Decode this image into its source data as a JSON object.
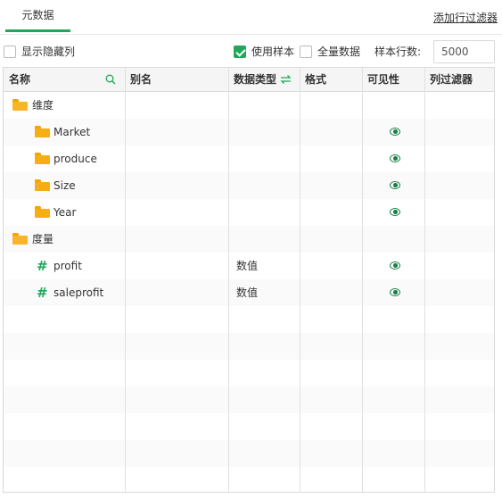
{
  "tabs": [
    {
      "label": "元数据",
      "active": true
    }
  ],
  "add_filter_label": "添加行过滤器",
  "toolbar": {
    "show_hidden_label": "显示隐藏列",
    "show_hidden_checked": false,
    "use_sample_label": "使用样本",
    "use_sample_checked": true,
    "full_data_label": "全量数据",
    "full_data_checked": false,
    "sample_rows_label": "样本行数:",
    "sample_rows_value": "5000"
  },
  "columns": {
    "name": "名称",
    "alias": "别名",
    "datatype": "数据类型",
    "format": "格式",
    "visibility": "可见性",
    "col_filter": "列过滤器"
  },
  "rows": [
    {
      "name": "维度",
      "icon": "folder-open-icon",
      "datatype": "",
      "visible": false
    },
    {
      "name": "Market",
      "icon": "folder-icon",
      "datatype": "",
      "visible": true
    },
    {
      "name": "produce",
      "icon": "folder-icon",
      "datatype": "",
      "visible": true
    },
    {
      "name": "Size",
      "icon": "folder-icon",
      "datatype": "",
      "visible": true
    },
    {
      "name": "Year",
      "icon": "folder-icon",
      "datatype": "",
      "visible": true
    },
    {
      "name": "度量",
      "icon": "folder-open-icon",
      "datatype": "",
      "visible": false
    },
    {
      "name": "profit",
      "icon": "hash-icon",
      "datatype": "数值",
      "visible": true
    },
    {
      "name": "saleprofit",
      "icon": "hash-icon",
      "datatype": "数值",
      "visible": true
    }
  ],
  "colors": {
    "accent": "#1fa85a",
    "folder": "#f7ae14",
    "eye": "#1a7f45"
  }
}
